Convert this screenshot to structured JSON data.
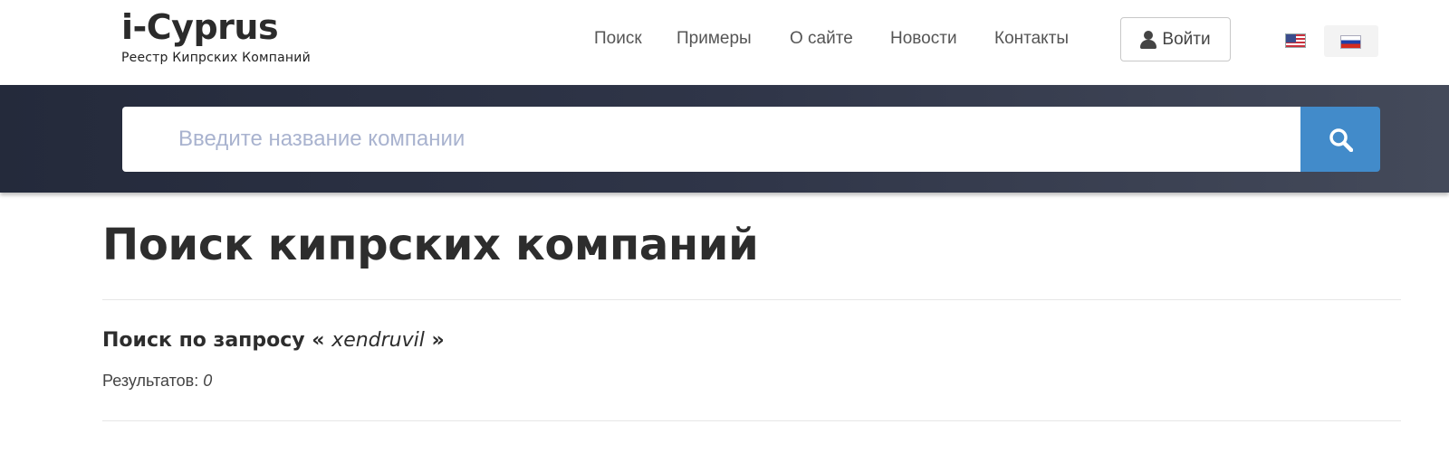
{
  "brand": {
    "title": "i-Cyprus",
    "subtitle": "Реестр Кипрских Компаний"
  },
  "nav": {
    "items": [
      {
        "label": "Поиск"
      },
      {
        "label": "Примеры"
      },
      {
        "label": "О сайте"
      },
      {
        "label": "Новости"
      },
      {
        "label": "Контакты"
      }
    ],
    "login_label": "Войти",
    "login_icon": "user-icon",
    "languages": [
      {
        "code": "en",
        "icon": "us-flag-icon",
        "active": false
      },
      {
        "code": "ru",
        "icon": "ru-flag-icon",
        "active": true
      }
    ]
  },
  "search": {
    "placeholder": "Введите название компании",
    "value": "",
    "button_icon": "search-icon",
    "button_color": "#428bca"
  },
  "main": {
    "title": "Поиск кипрских компаний",
    "query_prefix": "Поиск по запросу «",
    "query_term": "xendruvil",
    "query_suffix": "»",
    "results_label": "Результатов:",
    "results_count": "0"
  }
}
